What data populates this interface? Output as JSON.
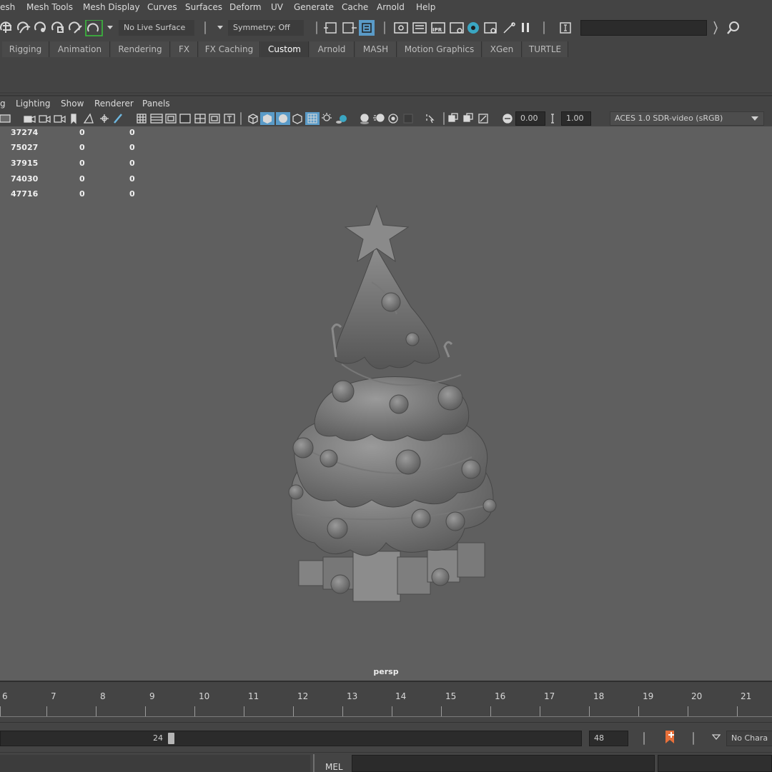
{
  "menubar": {
    "items": [
      "esh",
      "Mesh Tools",
      "Mesh Display",
      "Curves",
      "Surfaces",
      "Deform",
      "UV",
      "Generate",
      "Cache",
      "Arnold",
      "Help"
    ]
  },
  "statusline": {
    "live_surface": "No Live Surface",
    "symmetry": "Symmetry: Off"
  },
  "shelf": {
    "tabs": [
      "Rigging",
      "Animation",
      "Rendering",
      "FX",
      "FX Caching",
      "Custom",
      "Arnold",
      "MASH",
      "Motion Graphics",
      "XGen",
      "TURTLE"
    ],
    "active_tab": "Custom"
  },
  "panel": {
    "menu": [
      "g",
      "Lighting",
      "Show",
      "Renderer",
      "Panels"
    ],
    "exposure": "0.00",
    "gamma": "1.00",
    "color_space": "ACES 1.0 SDR-video (sRGB)"
  },
  "hud": {
    "rows": [
      {
        "a": "37274",
        "b": "0",
        "c": "0"
      },
      {
        "a": "75027",
        "b": "0",
        "c": "0"
      },
      {
        "a": "37915",
        "b": "0",
        "c": "0"
      },
      {
        "a": "74030",
        "b": "0",
        "c": "0"
      },
      {
        "a": "47716",
        "b": "0",
        "c": "0"
      }
    ]
  },
  "viewport": {
    "camera": "persp"
  },
  "timeslider": {
    "frames": [
      "6",
      "7",
      "8",
      "9",
      "10",
      "11",
      "12",
      "13",
      "14",
      "15",
      "16",
      "17",
      "18",
      "19",
      "20",
      "21"
    ]
  },
  "range": {
    "start_value": "24",
    "end_value": "48",
    "character_set": "No Chara"
  },
  "cmdline": {
    "language": "MEL"
  },
  "colors": {
    "ui_bg": "#444444",
    "viewport_bg": "#5f5f5f",
    "field_bg": "#2b2b2b",
    "highlight_blue": "#5a9bc8",
    "key_orange": "#e8703a",
    "snap_green": "#39c43c"
  }
}
